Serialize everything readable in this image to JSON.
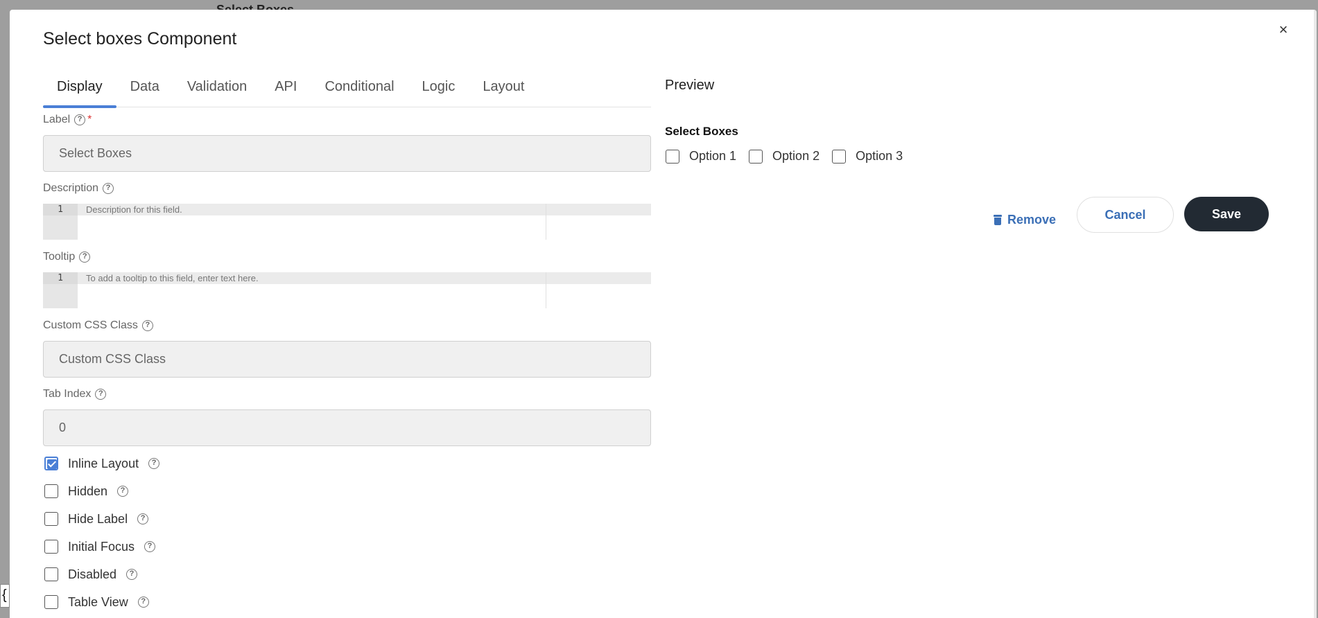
{
  "background": {
    "title": "Select Boxes",
    "edge_glyph": "{"
  },
  "modal": {
    "title": "Select boxes Component",
    "close_symbol": "×"
  },
  "tabs": [
    {
      "label": "Display",
      "active": true
    },
    {
      "label": "Data",
      "active": false
    },
    {
      "label": "Validation",
      "active": false
    },
    {
      "label": "API",
      "active": false
    },
    {
      "label": "Conditional",
      "active": false
    },
    {
      "label": "Logic",
      "active": false
    },
    {
      "label": "Layout",
      "active": false
    }
  ],
  "fields": {
    "label": {
      "label": "Label",
      "required_mark": "*",
      "value": "Select Boxes"
    },
    "description": {
      "label": "Description",
      "line_number": "1",
      "placeholder": "Description for this field."
    },
    "tooltip": {
      "label": "Tooltip",
      "line_number": "1",
      "placeholder": "To add a tooltip to this field, enter text here."
    },
    "custom_css": {
      "label": "Custom CSS Class",
      "placeholder": "Custom CSS Class"
    },
    "tab_index": {
      "label": "Tab Index",
      "placeholder": "0"
    }
  },
  "checkboxes": [
    {
      "label": "Inline Layout",
      "checked": true
    },
    {
      "label": "Hidden",
      "checked": false
    },
    {
      "label": "Hide Label",
      "checked": false
    },
    {
      "label": "Initial Focus",
      "checked": false
    },
    {
      "label": "Disabled",
      "checked": false
    },
    {
      "label": "Table View",
      "checked": false
    }
  ],
  "help_glyph": "?",
  "preview": {
    "title": "Preview",
    "component_label": "Select Boxes",
    "options": [
      "Option 1",
      "Option 2",
      "Option 3"
    ]
  },
  "actions": {
    "remove_label": "Remove",
    "cancel_label": "Cancel",
    "save_label": "Save"
  },
  "colors": {
    "accent": "#4a7fd6",
    "link": "#3b6fb6",
    "save_bg": "#222a33",
    "overlay": "#9e9e9e"
  }
}
